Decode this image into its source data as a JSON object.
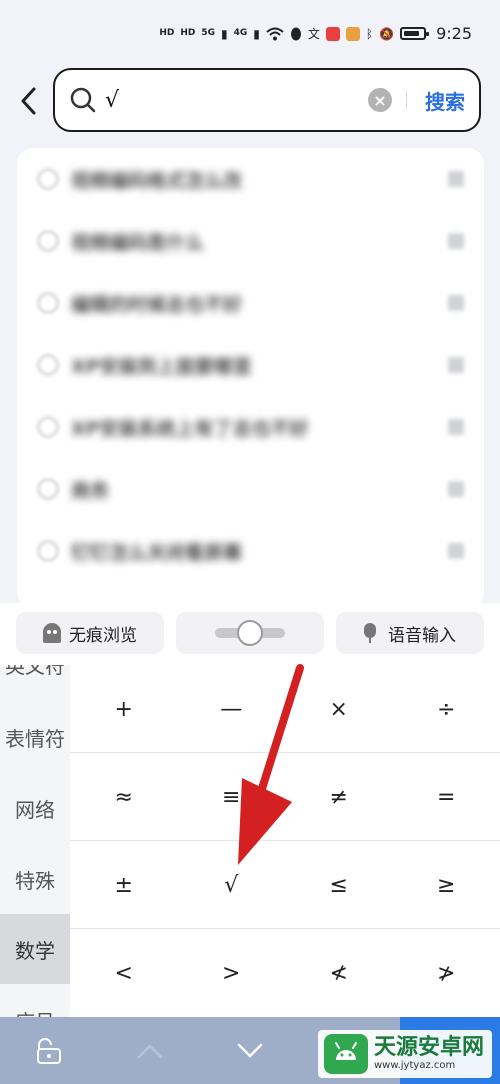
{
  "status_bar": {
    "hd1": "HD",
    "hd2": "HD",
    "net1": "5G",
    "net2": "4G",
    "time": "9:25"
  },
  "search": {
    "query": "√",
    "clear_label": "×",
    "submit_label": "搜索"
  },
  "suggestions": [
    {
      "text": "视频编码格式怎么改"
    },
    {
      "text": "视频编码是什么"
    },
    {
      "text": "编辑的时候总也不好"
    },
    {
      "text": "XP安装到上面要哪里"
    },
    {
      "text": "XP安装系统上有了总也不好"
    },
    {
      "text": "商务"
    },
    {
      "text": "钉钉怎么关闭看屏幕"
    }
  ],
  "toolbar": {
    "incognito_label": "无痕浏览",
    "voice_label": "语音输入"
  },
  "categories": [
    {
      "label": "英文符"
    },
    {
      "label": "表情符"
    },
    {
      "label": "网络"
    },
    {
      "label": "特殊"
    },
    {
      "label": "数学"
    },
    {
      "label": "序号"
    }
  ],
  "symbols": [
    [
      "+",
      "—",
      "×",
      "÷"
    ],
    [
      "≈",
      "≡",
      "≠",
      "="
    ],
    [
      "±",
      "√",
      "≤",
      "≥"
    ],
    [
      "<",
      ">",
      "≮",
      "≯"
    ]
  ],
  "watermark": {
    "title": "天源安卓网",
    "url": "www.jytyaz.com"
  },
  "colors": {
    "accent": "#2b6fe0",
    "annotation": "#d42020",
    "bottom_bar": "#9eadc8"
  }
}
